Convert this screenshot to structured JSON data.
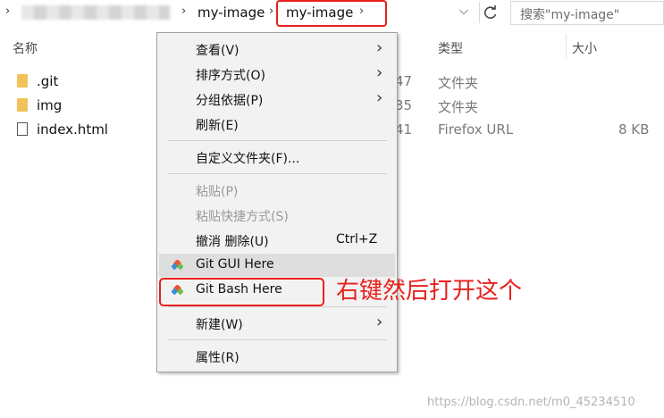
{
  "address": {
    "crumbs": [
      "my-image",
      "my-image"
    ],
    "search_placeholder": "搜索\"my-image\""
  },
  "columns": {
    "name": "名称",
    "type": "类型",
    "size": "大小"
  },
  "files": [
    {
      "name": ".git",
      "date_tail": "47",
      "type": "文件夹",
      "size": "",
      "kind": "folder"
    },
    {
      "name": "img",
      "date_tail": "35",
      "type": "文件夹",
      "size": "",
      "kind": "folder"
    },
    {
      "name": "index.html",
      "date_tail": "41",
      "type": "Firefox URL",
      "size": "8 KB",
      "kind": "file"
    }
  ],
  "menu": {
    "view": "查看(V)",
    "sort": "排序方式(O)",
    "group": "分组依据(P)",
    "refresh": "刷新(E)",
    "customize": "自定义文件夹(F)...",
    "paste": "粘贴(P)",
    "paste_shortcut": "粘贴快捷方式(S)",
    "undo": "撤消 删除(U)",
    "undo_shortcut": "Ctrl+Z",
    "git_gui": "Git GUI Here",
    "git_bash": "Git Bash Here",
    "new": "新建(W)",
    "properties": "属性(R)"
  },
  "annotation": "右键然后打开这个",
  "watermark": "https://blog.csdn.net/m0_45234510",
  "colors": {
    "highlight": "#e8201c",
    "git_red": "#f05133",
    "git_green": "#6cc04a",
    "git_blue": "#3c8fd6"
  }
}
